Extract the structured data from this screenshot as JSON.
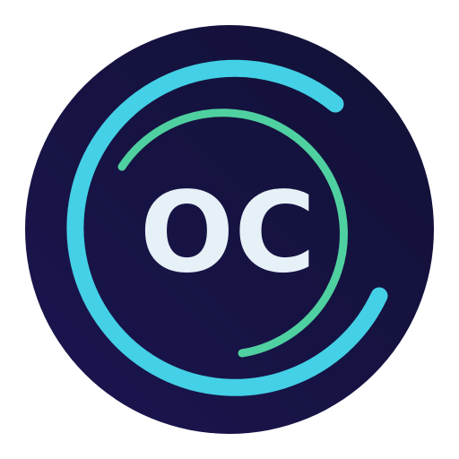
{
  "logo": {
    "monogram": "OC"
  },
  "colors": {
    "background": "#ffffff",
    "disc_light": "#1b1550",
    "disc_dark": "#111135",
    "outer_arc": "#44d0e6",
    "inner_arc": "#4fd0a0",
    "monogram": "#e6f0f7"
  }
}
